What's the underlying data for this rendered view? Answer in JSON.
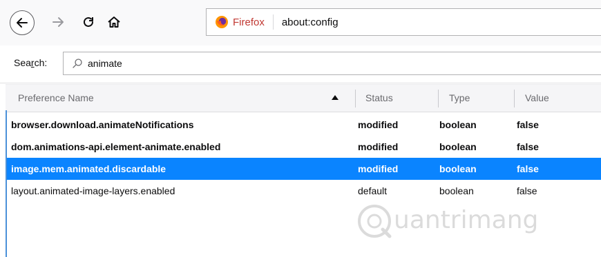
{
  "browser": {
    "identity_label": "Firefox",
    "url": "about:config"
  },
  "search": {
    "label_pre": "Sea",
    "label_access": "r",
    "label_post": "ch:",
    "value": "animate"
  },
  "columns": {
    "name": "Preference Name",
    "status": "Status",
    "type": "Type",
    "value": "Value",
    "sorted_by": "name",
    "sort_direction": "ascending"
  },
  "rows": [
    {
      "name": "browser.download.animateNotifications",
      "status": "modified",
      "type": "boolean",
      "value": "false",
      "selected": false
    },
    {
      "name": "dom.animations-api.element-animate.enabled",
      "status": "modified",
      "type": "boolean",
      "value": "false",
      "selected": false
    },
    {
      "name": "image.mem.animated.discardable",
      "status": "modified",
      "type": "boolean",
      "value": "false",
      "selected": true
    },
    {
      "name": "layout.animated-image-layers.enabled",
      "status": "default",
      "type": "boolean",
      "value": "false",
      "selected": false
    }
  ],
  "watermark": {
    "text": "uantrimang"
  },
  "colors": {
    "selection": "#0a84ff",
    "identity": "#c13832",
    "firefox_orange": "#ff9400"
  }
}
